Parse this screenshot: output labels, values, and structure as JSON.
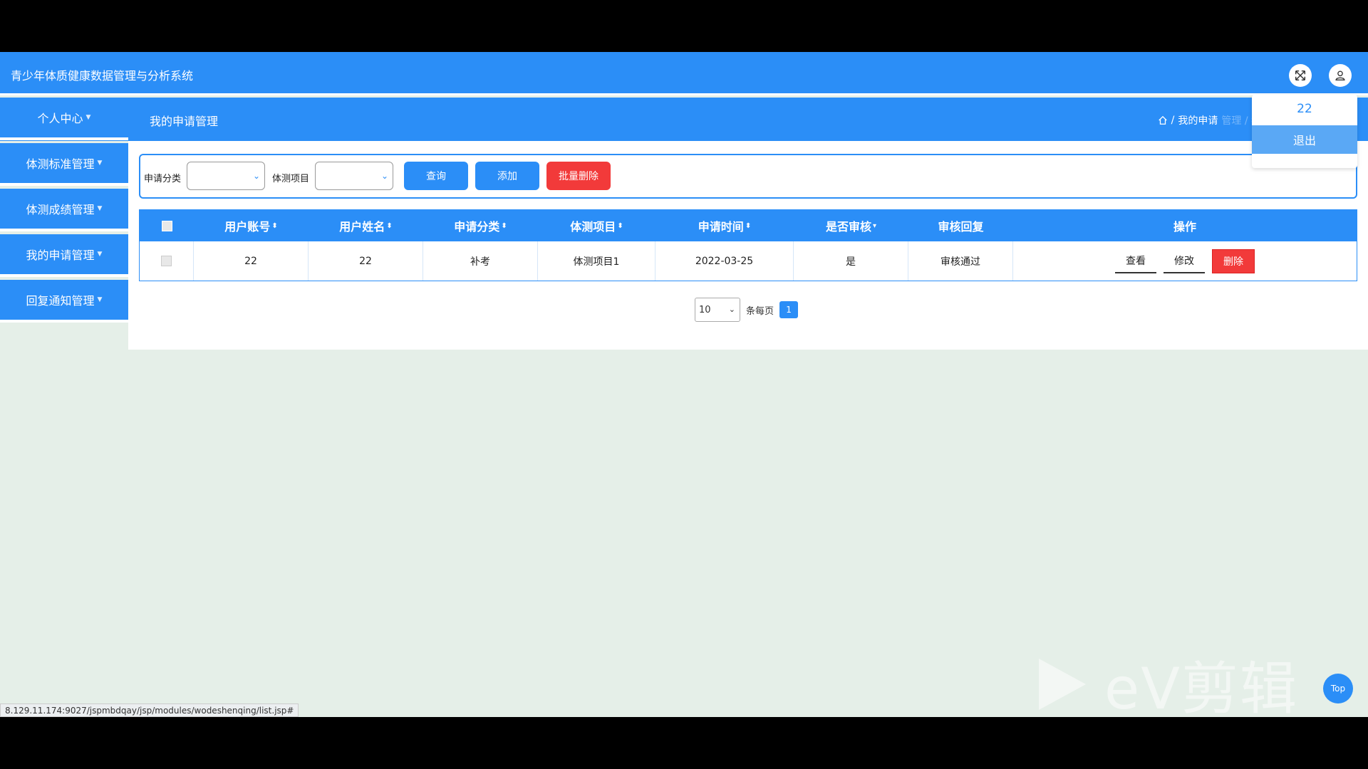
{
  "header": {
    "app_title": "青少年体质健康数据管理与分析系统",
    "nav_label": "我的申请管理",
    "breadcrumb": {
      "current": "我的申请",
      "faded": "管理 / 我的申请列表"
    }
  },
  "sidebar": {
    "items": [
      {
        "label": "个人中心"
      },
      {
        "label": "体测标准管理"
      },
      {
        "label": "体测成绩管理"
      },
      {
        "label": "我的申请管理"
      },
      {
        "label": "回复通知管理"
      }
    ]
  },
  "search": {
    "category_label": "申请分类",
    "project_label": "体测项目",
    "query_btn": "查询",
    "add_btn": "添加",
    "batch_delete_btn": "批量删除"
  },
  "table": {
    "headers": [
      "用户账号",
      "用户姓名",
      "申请分类",
      "体测项目",
      "申请时间",
      "是否审核",
      "审核回复",
      "操作"
    ],
    "rows": [
      {
        "account": "22",
        "name": "22",
        "category": "补考",
        "project": "体测项目1",
        "time": "2022-03-25",
        "audited": "是",
        "reply": "审核通过"
      }
    ],
    "actions": {
      "view": "查看",
      "edit": "修改",
      "delete": "删除"
    }
  },
  "pager": {
    "page_size": "10",
    "per_page_label": "条每页",
    "current_page": "1"
  },
  "user_menu": {
    "username": "22",
    "logout": "退出"
  },
  "status_url": "8.129.11.174:9027/jspmbdqay/jsp/modules/wodeshenqing/list.jsp#",
  "top_button": "Top",
  "watermark": "eV剪辑",
  "colors": {
    "primary": "#2b8ef7",
    "danger": "#f23a3a",
    "background": "#e5efe8"
  }
}
